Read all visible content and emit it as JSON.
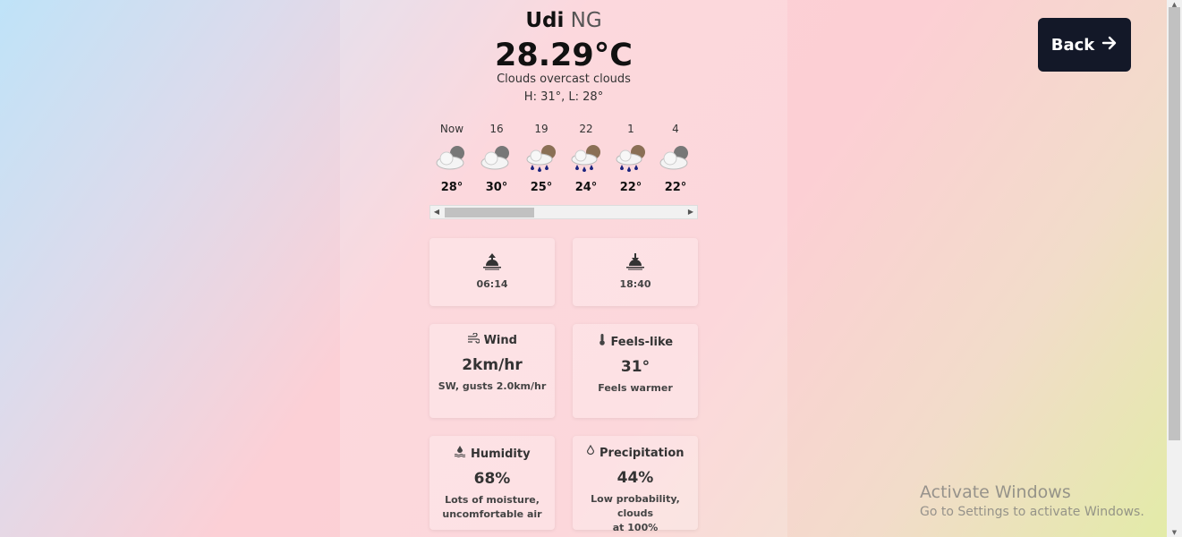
{
  "location": {
    "city": "Udi",
    "country": "NG"
  },
  "current": {
    "temperature": "28.29°C",
    "description": "Clouds overcast clouds",
    "high_low": "H: 31°, L: 28°"
  },
  "hourly": [
    {
      "time": "Now",
      "icon": "cloudy-icon",
      "temp": "28°"
    },
    {
      "time": "16",
      "icon": "cloudy-icon",
      "temp": "30°"
    },
    {
      "time": "19",
      "icon": "rain-cloud-icon",
      "temp": "25°"
    },
    {
      "time": "22",
      "icon": "rain-cloud-icon",
      "temp": "24°"
    },
    {
      "time": "1",
      "icon": "rain-cloud-icon",
      "temp": "22°"
    },
    {
      "time": "4",
      "icon": "cloudy-icon",
      "temp": "22°"
    }
  ],
  "sun": {
    "sunrise": "06:14",
    "sunset": "18:40"
  },
  "wind": {
    "label": "Wind",
    "value": "2km/hr",
    "detail": "SW, gusts 2.0km/hr"
  },
  "feels_like": {
    "label": "Feels-like",
    "value": "31°",
    "detail": "Feels warmer"
  },
  "humidity": {
    "label": "Humidity",
    "value": "68%",
    "detail_line1": "Lots of moisture,",
    "detail_line2": "uncomfortable air"
  },
  "precipitation": {
    "label": "Precipitation",
    "value": "44%",
    "detail_line1": "Low probability, clouds",
    "detail_line2": "at 100%"
  },
  "back_button": {
    "label": "Back"
  },
  "watermark": {
    "line1": "Activate Windows",
    "line2": "Go to Settings to activate Windows."
  }
}
